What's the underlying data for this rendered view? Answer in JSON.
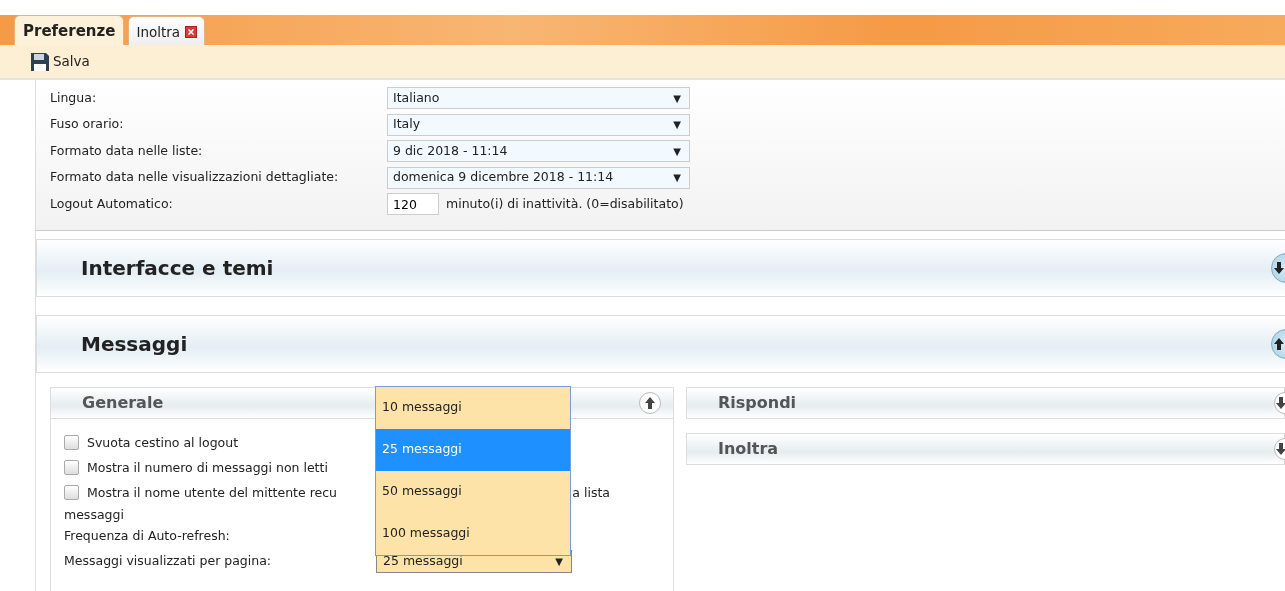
{
  "tabs": [
    {
      "label": "Preferenze",
      "selected": true,
      "closable": false
    },
    {
      "label": "Inoltra",
      "selected": false,
      "closable": true
    }
  ],
  "toolbar": {
    "save_label": "Salva"
  },
  "settings": [
    {
      "label": "Lingua:",
      "kind": "select",
      "value": "Italiano",
      "caret": "▼"
    },
    {
      "label": "Fuso orario:",
      "kind": "select",
      "value": "Italy",
      "caret": "▼"
    },
    {
      "label": "Formato data nelle liste:",
      "kind": "select",
      "value": "9 dic 2018 - 11:14",
      "caret": "▼"
    },
    {
      "label": "Formato data nelle visualizzazioni dettagliate:",
      "kind": "select",
      "value": "domenica 9 dicembre 2018 - 11:14",
      "caret": "▼"
    },
    {
      "label": "Logout Automatico:",
      "kind": "number",
      "value": "120",
      "suffix": "minuto(i) di inattività. (0=disabilitato)"
    }
  ],
  "sections": [
    {
      "title": "Interfacce e temi",
      "expanded": false
    },
    {
      "title": "Messaggi",
      "expanded": true
    }
  ],
  "left_panels": [
    {
      "title": "Generale",
      "expanded": true,
      "rows": [
        {
          "kind": "checkbox",
          "checked": false,
          "label": "Svuota cestino al logout"
        },
        {
          "kind": "checkbox",
          "checked": false,
          "label": "Mostra il numero di messaggi non letti"
        },
        {
          "kind": "checkbox",
          "checked": false,
          "label": "Mostra il nome utente del mittente recu",
          "label_after": "a lista",
          "label_wrap": "messaggi"
        },
        {
          "kind": "field",
          "label": "Frequenza di Auto-refresh:"
        },
        {
          "kind": "select",
          "label": "Messaggi visualizzati per pagina:",
          "value": "25 messaggi",
          "caret": "▼",
          "open": true,
          "options": [
            {
              "label": "10 messaggi",
              "selected": false
            },
            {
              "label": "25 messaggi",
              "selected": true
            },
            {
              "label": "50 messaggi",
              "selected": false
            },
            {
              "label": "100 messaggi",
              "selected": false
            }
          ]
        }
      ]
    }
  ],
  "right_panels": [
    {
      "title": "Rispondi",
      "expanded": false
    },
    {
      "title": "Inoltra",
      "expanded": false
    }
  ]
}
